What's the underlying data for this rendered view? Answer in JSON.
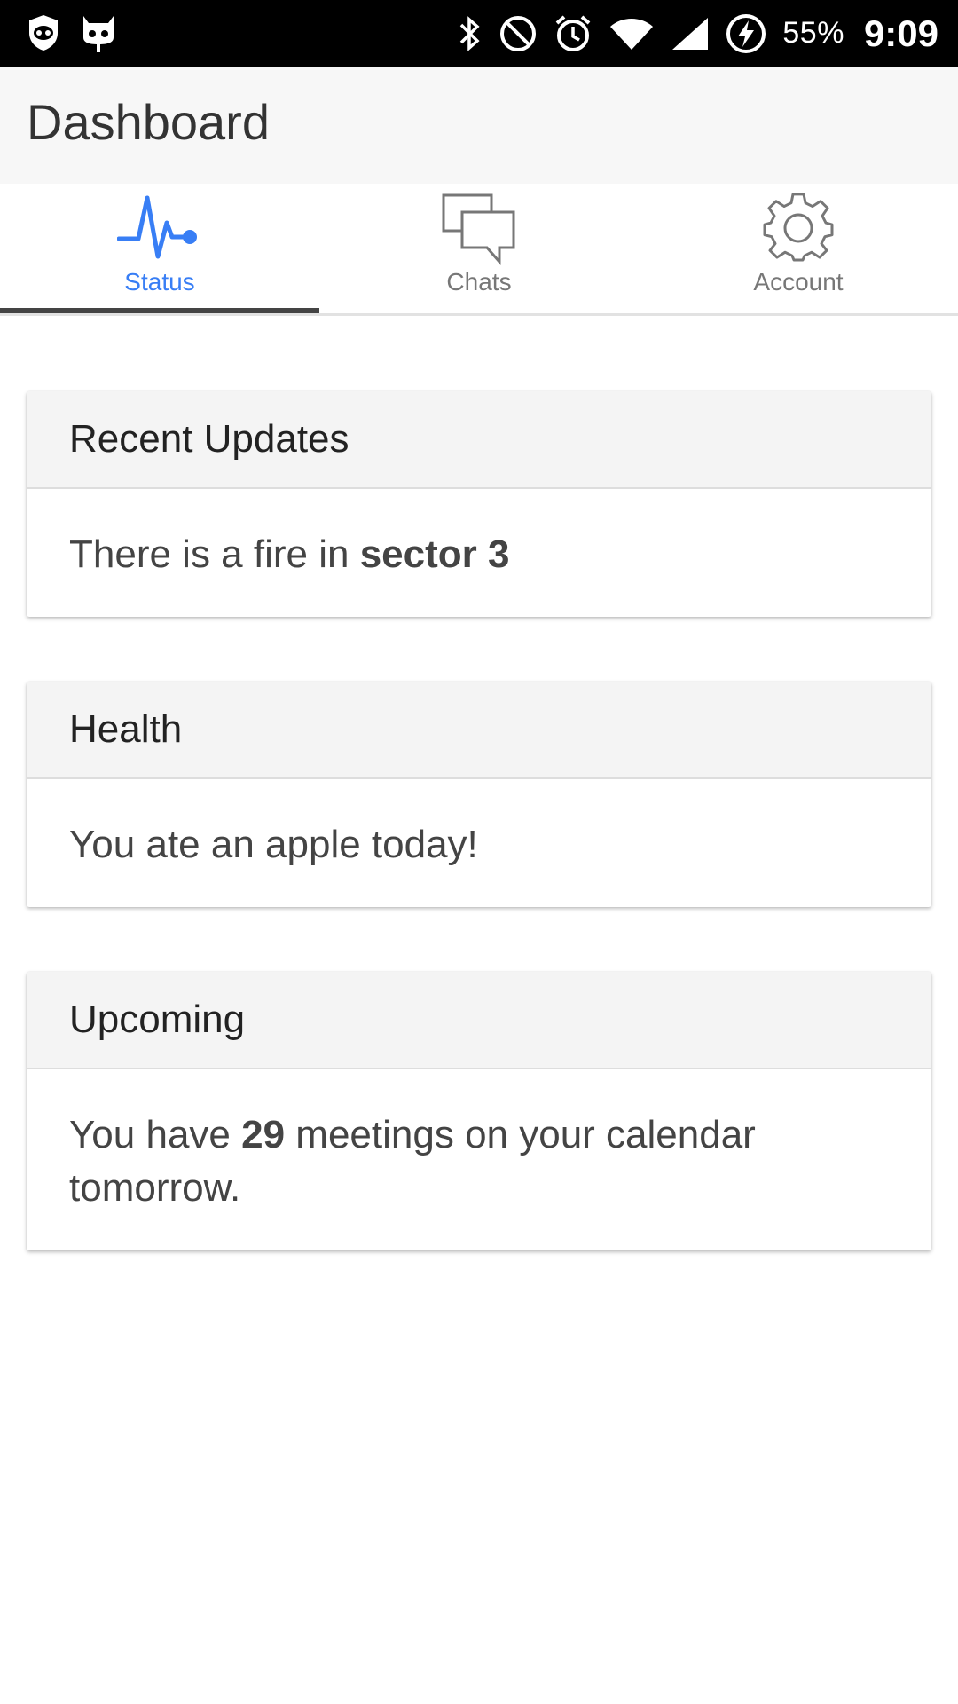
{
  "status_bar": {
    "battery_percent": "55%",
    "time": "9:09",
    "left_icons": [
      "shield-icon",
      "cyanogen-mascot-icon"
    ],
    "right_icons": [
      "bluetooth-icon",
      "do-not-disturb-icon",
      "alarm-icon",
      "wifi-icon",
      "signal-icon",
      "battery-charging-icon"
    ]
  },
  "app_bar": {
    "title": "Dashboard"
  },
  "tabs": [
    {
      "label": "Status",
      "icon": "pulse-icon",
      "active": true
    },
    {
      "label": "Chats",
      "icon": "chat-bubbles-icon",
      "active": false
    },
    {
      "label": "Account",
      "icon": "gear-icon",
      "active": false
    }
  ],
  "colors": {
    "accent": "#387ef5",
    "status_bar": "#000000",
    "app_bar": "#f7f7f7",
    "card_header": "#f4f4f4",
    "inactive_tab": "#777777"
  },
  "cards": [
    {
      "title": "Recent Updates",
      "text_before": "There is a fire in ",
      "text_bold": "sector 3",
      "text_after": ""
    },
    {
      "title": "Health",
      "text_before": "You ate an apple today!",
      "text_bold": "",
      "text_after": ""
    },
    {
      "title": "Upcoming",
      "text_before": "You have ",
      "text_bold": "29",
      "text_after": " meetings on your calendar tomorrow."
    }
  ]
}
